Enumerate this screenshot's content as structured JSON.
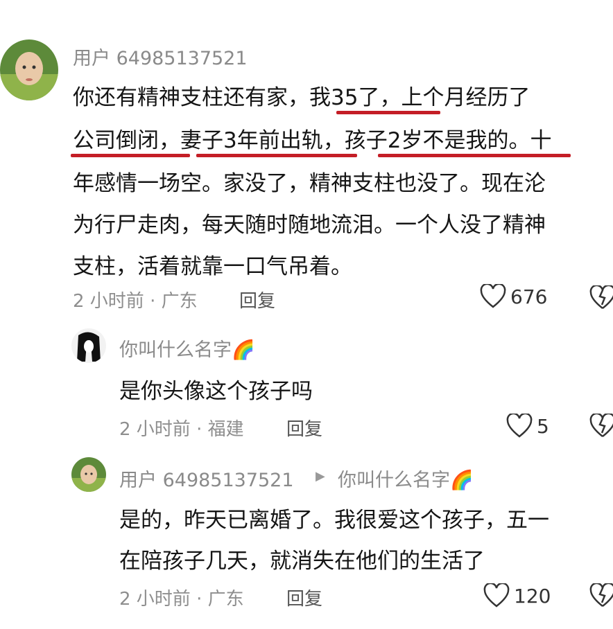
{
  "comment1": {
    "username": "用户 64985137521",
    "lines": [
      "你还有精神支柱还有家，我35了，上个月经历了",
      "公司倒闭，妻子3年前出轨，孩子2岁不是我的。十",
      "年感情一场空。家没了，精神支柱也没了。现在沦",
      "为行尸走肉，每天随时随地流泪。一个人没了精神",
      "支柱，活着就靠一口气吊着。"
    ],
    "time": "2 小时前 · 广东",
    "reply_label": "回复",
    "likes": "676"
  },
  "reply1": {
    "username": "你叫什么名字🌈",
    "text": "是你头像这个孩子吗",
    "time": "2 小时前 · 福建",
    "reply_label": "回复",
    "likes": "5"
  },
  "reply2": {
    "username": "用户 64985137521",
    "reply_to": "你叫什么名字🌈",
    "lines": [
      "是的，昨天已离婚了。我很爱这个孩子，五一",
      "在陪孩子几天，就消失在他们的生活了"
    ],
    "time": "2 小时前 · 广东",
    "reply_label": "回复",
    "likes": "120"
  },
  "colors": {
    "underline": "#c41e26",
    "meta_text": "#8e8e8e",
    "body_text": "#151515"
  },
  "icons": [
    "heart-icon",
    "dislike-heart-icon",
    "play-arrow-icon"
  ]
}
